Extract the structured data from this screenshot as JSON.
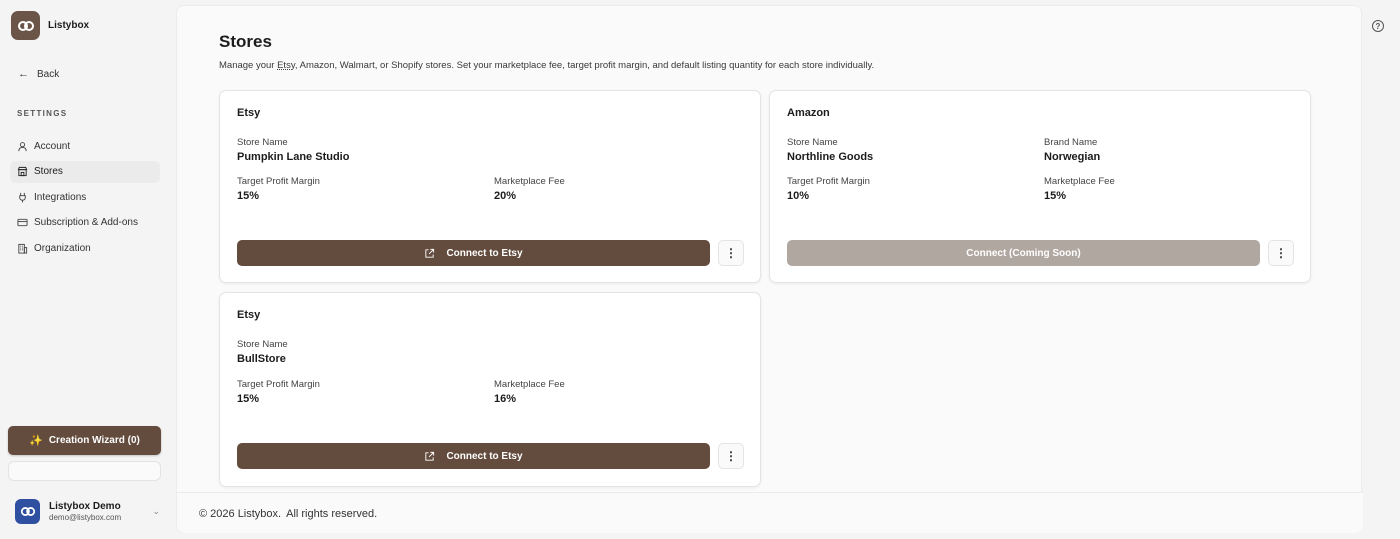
{
  "app": {
    "name": "Listybox"
  },
  "sidebar": {
    "back_label": "Back",
    "section_label": "SETTINGS",
    "items": [
      {
        "label": "Account",
        "icon": "user-icon",
        "active": false
      },
      {
        "label": "Stores",
        "icon": "store-icon",
        "active": true
      },
      {
        "label": "Integrations",
        "icon": "plug-icon",
        "active": false
      },
      {
        "label": "Subscription & Add-ons",
        "icon": "credit-card-icon",
        "active": false
      },
      {
        "label": "Organization",
        "icon": "building-icon",
        "active": false
      }
    ],
    "wizard_label": "Creation Wizard (0)",
    "user": {
      "name": "Listybox Demo",
      "email": "demo@listybox.com"
    }
  },
  "page": {
    "title": "Stores",
    "description_prefix": "Manage your ",
    "description_underlined": "Etsy",
    "description_suffix": ", Amazon, Walmart, or Shopify stores. Set your marketplace fee, target profit margin, and default listing quantity for each store individually."
  },
  "stores": [
    {
      "marketplace": "Etsy",
      "store_name_label": "Store Name",
      "store_name": "Pumpkin Lane Studio",
      "margin_label": "Target Profit Margin",
      "margin": "15%",
      "fee_label": "Marketplace Fee",
      "fee": "20%",
      "button_label": "Connect to Etsy"
    },
    {
      "marketplace": "Amazon",
      "store_name_label": "Store Name",
      "store_name": "Northline Goods",
      "brand_label": "Brand Name",
      "brand": "Norwegian",
      "margin_label": "Target Profit Margin",
      "margin": "10%",
      "fee_label": "Marketplace Fee",
      "fee": "15%",
      "button_label": "Connect (Coming Soon)"
    },
    {
      "marketplace": "Etsy",
      "store_name_label": "Store Name",
      "store_name": "BullStore",
      "margin_label": "Target Profit Margin",
      "margin": "15%",
      "fee_label": "Marketplace Fee",
      "fee": "16%",
      "button_label": "Connect to Etsy"
    }
  ],
  "footer": {
    "copyright": "© 2026 Listybox.",
    "rights": "All rights reserved."
  },
  "colors": {
    "accent": "#634b3d",
    "disabled_button": "#b1a7a1",
    "avatar": "#2f4fa0"
  }
}
